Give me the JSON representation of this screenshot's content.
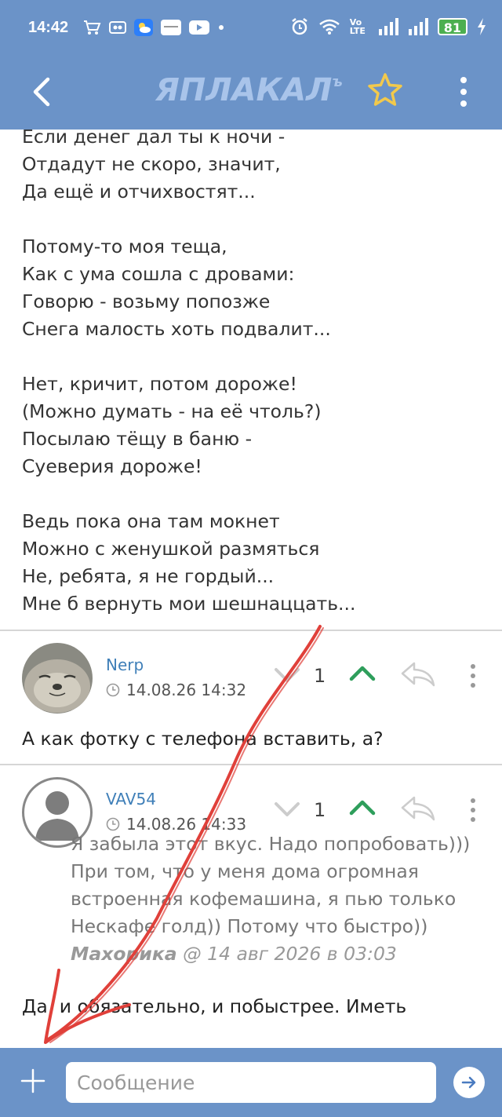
{
  "status_bar": {
    "time": "14:42",
    "battery": "81",
    "network_label": "Vo LTE",
    "icons_left": [
      "cart-icon",
      "app-icon",
      "weather-icon",
      "news-icon",
      "youtube-icon",
      "dot-icon"
    ],
    "icons_right": [
      "alarm-icon",
      "wifi-icon",
      "signal-icon",
      "signal-icon",
      "battery-icon",
      "charging-icon"
    ]
  },
  "header": {
    "logo_text": "ЯПЛАКАЛ",
    "logo_suffix": "ъ",
    "accent_color": "#6b93c8",
    "star_color": "#f2c94c"
  },
  "poem": {
    "stanzas": [
      [
        "Если денег дал ты к ночи -",
        "Отдадут не скоро, значит,",
        "Да ещё и отчихвостят..."
      ],
      [
        "Потому-то моя теща,",
        "Как с ума сошла с дровами:",
        "Говорю - возьму попозже",
        "Снега малость хоть подвалит..."
      ],
      [
        "Нет, кричит, потом дороже!",
        "(Можно думать - на её чтоль?)",
        "Посылаю тёщу в баню -",
        "Суеверия дороже!"
      ],
      [
        "Ведь пока она там мокнет",
        "Можно с женушкой размяться",
        "Не, ребята, я не гордый...",
        "Мне б вернуть мои шешнаццать..."
      ]
    ]
  },
  "comments": [
    {
      "author": "Nerp",
      "date": "14.08.26 14:32",
      "score": "1",
      "text": "А как фотку с телефона вставить, а?"
    },
    {
      "author": "VAV54",
      "date": "14.08.26 14:33",
      "score": "1",
      "quote_lines": [
        "Я забыла этот вкус. Надо попробовать)))",
        "При том, что у меня дома огромная",
        "встроенная кофемашина, я пью только",
        "Нескафе голд)) Потому что быстро))"
      ],
      "quote_author": "Махорика",
      "quote_date": " @ 14 авг 2026 в 03:03",
      "text": "Да, и обязательно, и побыстрее. Иметь"
    }
  ],
  "composer": {
    "placeholder": "Сообщение"
  },
  "colors": {
    "vote_up": "#2e9e5b",
    "vote_down": "#cccccc",
    "annotation_red": "#e0403a"
  }
}
